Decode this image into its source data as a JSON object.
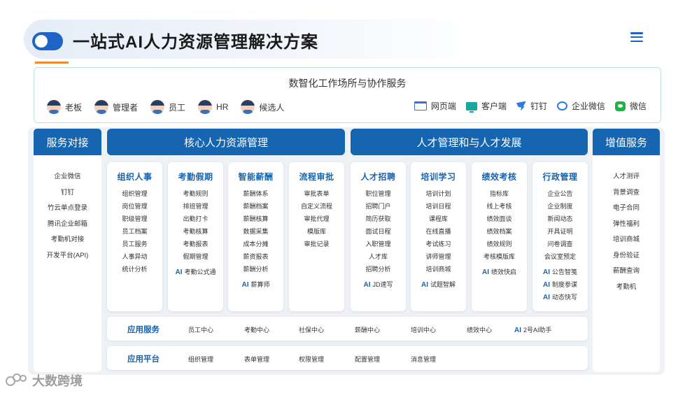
{
  "header": {
    "title": "一站式AI人力资源管理解决方案"
  },
  "top": {
    "title": "数智化工作场所与协作服务",
    "roles": [
      {
        "label": "老板",
        "icon": "boss-avatar-icon"
      },
      {
        "label": "管理者",
        "icon": "manager-avatar-icon"
      },
      {
        "label": "员工",
        "icon": "employee-avatar-icon"
      },
      {
        "label": "HR",
        "icon": "hr-avatar-icon"
      },
      {
        "label": "候选人",
        "icon": "candidate-avatar-icon"
      }
    ],
    "clients": [
      {
        "label": "网页端",
        "icon": "web-icon"
      },
      {
        "label": "客户端",
        "icon": "desktop-icon"
      },
      {
        "label": "钉钉",
        "icon": "dingtalk-icon"
      },
      {
        "label": "企业微信",
        "icon": "wecom-icon"
      },
      {
        "label": "微信",
        "icon": "wechat-icon"
      }
    ]
  },
  "columns": {
    "left": "服务对接",
    "core": "核心人力资源管理",
    "talent": "人才管理和与人才发展",
    "value": "增值服务"
  },
  "left_items": [
    "企业微信",
    "钉钉",
    "竹云单点登录",
    "腾讯企业邮箱",
    "考勤机对接",
    "开发平台(API)"
  ],
  "right_items": [
    "人才测评",
    "背景调查",
    "电子合同",
    "弹性福利",
    "培训商城",
    "身份验证",
    "薪酬查询",
    "考勤机"
  ],
  "ai_tag": "AI",
  "modules": [
    {
      "title": "组织人事",
      "items": [
        "组织管理",
        "岗位管理",
        "职级管理",
        "员工档案",
        "员工服务",
        "人事异动",
        "统计分析"
      ],
      "ai": []
    },
    {
      "title": "考勤假期",
      "items": [
        "考勤规则",
        "排班管理",
        "出勤打卡",
        "考勤核算",
        "考勤报表",
        "假期管理"
      ],
      "ai": [
        "考勤公式通"
      ]
    },
    {
      "title": "智能薪酬",
      "items": [
        "薪酬体系",
        "薪酬档案",
        "薪酬核算",
        "数据采集",
        "成本分摊",
        "薪资报表",
        "薪酬分析"
      ],
      "ai": [
        "薪算师"
      ]
    },
    {
      "title": "流程审批",
      "items": [
        "审批表单",
        "自定义流程",
        "审批代理",
        "模版库",
        "审批记录"
      ],
      "ai": []
    },
    {
      "title": "人才招聘",
      "items": [
        "职位管理",
        "招聘门户",
        "简历获取",
        "面试日程",
        "入职管理",
        "人才库",
        "招聘分析"
      ],
      "ai": [
        "JD速写"
      ]
    },
    {
      "title": "培训学习",
      "items": [
        "培训计划",
        "培训日程",
        "课程库",
        "在线直播",
        "考试练习",
        "讲师管理",
        "培训商城"
      ],
      "ai": [
        "试题智解"
      ]
    },
    {
      "title": "绩效考核",
      "items": [
        "指标库",
        "线上考核",
        "绩效面谈",
        "绩效档案",
        "绩效规则",
        "考核模版库"
      ],
      "ai": [
        "绩效快启"
      ]
    },
    {
      "title": "行政管理",
      "items": [
        "企业公告",
        "企业制度",
        "新闻动态",
        "开具证明",
        "问卷调查",
        "会议室预定"
      ],
      "ai": [
        "公告智笺",
        "制度参谋",
        "动态快写"
      ]
    }
  ],
  "app_services": {
    "label": "应用服务",
    "items": [
      "员工中心",
      "考勤中心",
      "社保中心",
      "薪酬中心",
      "培训中心",
      "绩效中心"
    ],
    "ai_item": "2号AI助手"
  },
  "app_platform": {
    "label": "应用平台",
    "items": [
      "组织管理",
      "表单管理",
      "权限管理",
      "配置管理",
      "消息管理"
    ]
  },
  "watermark": "大数跨境",
  "colors": {
    "primary": "#1565b0",
    "accent": "#f08a2e",
    "background_band": "#eef2f6"
  }
}
